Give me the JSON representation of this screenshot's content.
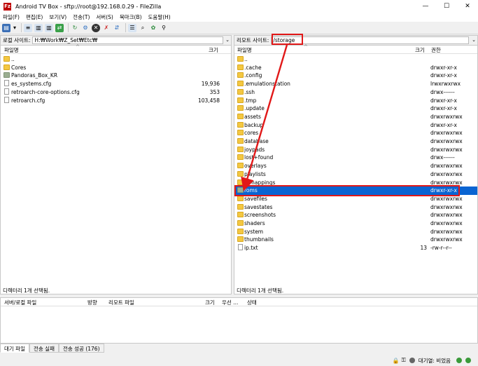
{
  "window": {
    "title": "Android TV Box - sftp://root@192.168.0.29 - FileZilla",
    "app_icon": "Fz"
  },
  "menu": [
    "파일(F)",
    "편집(E)",
    "보기(V)",
    "전송(T)",
    "서버(S)",
    "북마크(B)",
    "도움말(H)"
  ],
  "local": {
    "site_label": "로컬 사이트:",
    "path": "H:₩Work₩Z_Set₩Etc₩",
    "col_name": "파일명",
    "col_size": "크기",
    "rows": [
      {
        "name": "..",
        "size": "",
        "type": "folder"
      },
      {
        "name": "Cores",
        "size": "",
        "type": "folder"
      },
      {
        "name": "Pandoras_Box_KR",
        "size": "",
        "type": "folder-gray"
      },
      {
        "name": "es_systems.cfg",
        "size": "19,936",
        "type": "file"
      },
      {
        "name": "retroarch-core-options.cfg",
        "size": "353",
        "type": "file"
      },
      {
        "name": "retroarch.cfg",
        "size": "103,458",
        "type": "file"
      }
    ],
    "status": "디렉터리 1개 선택됨."
  },
  "remote": {
    "site_label": "리모트 사이트:",
    "path": "/storage",
    "col_name": "파일명",
    "col_size": "크기",
    "col_perm": "권한",
    "rows": [
      {
        "name": "..",
        "size": "",
        "perm": "",
        "type": "folder"
      },
      {
        "name": ".cache",
        "size": "",
        "perm": "drwxr-xr-x",
        "type": "folder"
      },
      {
        "name": ".config",
        "size": "",
        "perm": "drwxr-xr-x",
        "type": "folder"
      },
      {
        "name": ".emulationstation",
        "size": "",
        "perm": "lrwxrwxrwx",
        "type": "folder"
      },
      {
        "name": ".ssh",
        "size": "",
        "perm": "drwx------",
        "type": "folder"
      },
      {
        "name": ".tmp",
        "size": "",
        "perm": "drwxr-xr-x",
        "type": "folder"
      },
      {
        "name": ".update",
        "size": "",
        "perm": "drwxr-xr-x",
        "type": "folder"
      },
      {
        "name": "assets",
        "size": "",
        "perm": "drwxrwxrwx",
        "type": "folder"
      },
      {
        "name": "backup",
        "size": "",
        "perm": "drwxr-xr-x",
        "type": "folder"
      },
      {
        "name": "cores",
        "size": "",
        "perm": "drwxrwxrwx",
        "type": "folder"
      },
      {
        "name": "database",
        "size": "",
        "perm": "drwxrwxrwx",
        "type": "folder"
      },
      {
        "name": "joypads",
        "size": "",
        "perm": "drwxrwxrwx",
        "type": "folder"
      },
      {
        "name": "lost+found",
        "size": "",
        "perm": "drwx------",
        "type": "folder"
      },
      {
        "name": "overlays",
        "size": "",
        "perm": "drwxrwxrwx",
        "type": "folder"
      },
      {
        "name": "playlists",
        "size": "",
        "perm": "drwxrwxrwx",
        "type": "folder"
      },
      {
        "name": "remappings",
        "size": "",
        "perm": "drwxrwxrwx",
        "type": "folder"
      },
      {
        "name": "roms",
        "size": "",
        "perm": "drwxr-xr-x",
        "type": "folder-gray",
        "selected": true
      },
      {
        "name": "savefiles",
        "size": "",
        "perm": "drwxrwxrwx",
        "type": "folder"
      },
      {
        "name": "savestates",
        "size": "",
        "perm": "drwxrwxrwx",
        "type": "folder"
      },
      {
        "name": "screenshots",
        "size": "",
        "perm": "drwxrwxrwx",
        "type": "folder"
      },
      {
        "name": "shaders",
        "size": "",
        "perm": "drwxrwxrwx",
        "type": "folder"
      },
      {
        "name": "system",
        "size": "",
        "perm": "drwxrwxrwx",
        "type": "folder"
      },
      {
        "name": "thumbnails",
        "size": "",
        "perm": "drwxrwxrwx",
        "type": "folder"
      },
      {
        "name": "ip.txt",
        "size": "13",
        "perm": "-rw-r--r--",
        "type": "file"
      }
    ],
    "status": "디렉터리 1개 선택됨."
  },
  "queue": {
    "cols": [
      "서버/로컬 파일",
      "방향",
      "리모트 파일",
      "크기",
      "우선 ...",
      "상태"
    ]
  },
  "tabs": [
    "대기 파일",
    "전송 실패",
    "전송 성공 (176)"
  ],
  "statusbar": {
    "queue_text": "대기열: 비었음"
  },
  "colors": {
    "highlight": "#e11818",
    "selection": "#0a64d2"
  }
}
